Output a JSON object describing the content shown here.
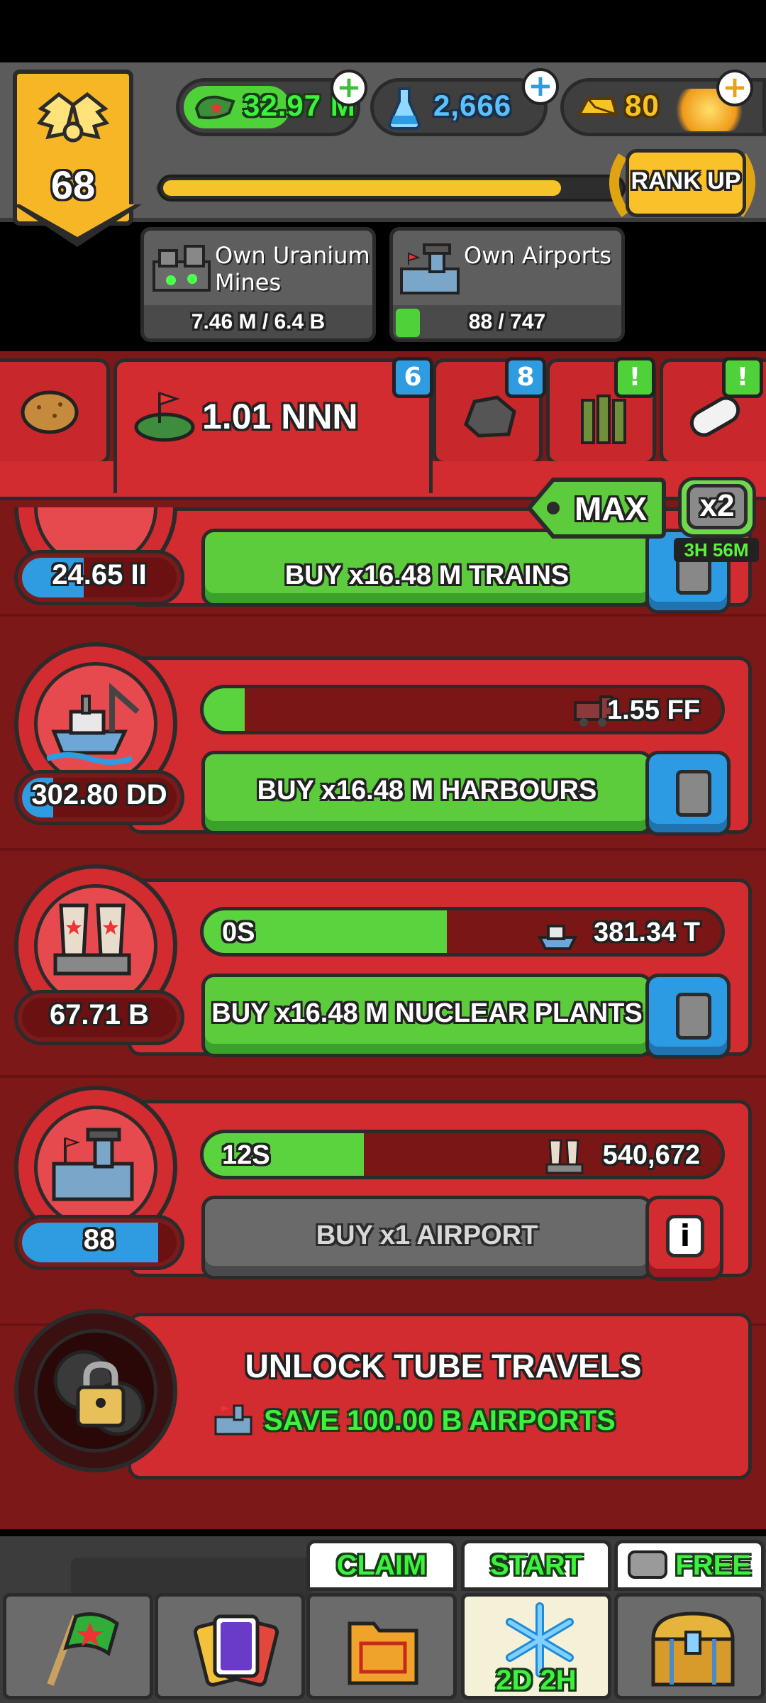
{
  "player": {
    "level": "68"
  },
  "resources": [
    {
      "name": "cash",
      "icon": "cash-icon",
      "value": "32.97 M"
    },
    {
      "name": "science",
      "icon": "flask-icon",
      "value": "2,666"
    },
    {
      "name": "gold",
      "icon": "gold-bar-icon",
      "value": "80"
    }
  ],
  "rank": {
    "button_label": "RANK UP",
    "progress_fraction": 0.86
  },
  "goals": [
    {
      "title_line1": "Own Uranium",
      "title_line2": "Mines",
      "progress": "7.46 M / 6.4 B",
      "icon": "uranium-mine-icon"
    },
    {
      "title_line1": "Own Airports",
      "title_line2": "",
      "progress": "88 / 747",
      "icon": "airport-icon"
    }
  ],
  "tabs": {
    "active_value": "1.01 NNN",
    "badges": [
      "6",
      "8",
      "!",
      "!"
    ]
  },
  "boost": {
    "max_label": "MAX",
    "multiplier_label": "x2",
    "timer": "3H 56M"
  },
  "rows": [
    {
      "name": "trains",
      "owned": "24.65 II",
      "buy_label": "BUY x16.48 M TRAINS"
    },
    {
      "name": "harbours",
      "owned": "302.80 DD",
      "bar_left": "",
      "bar_right": "1.55 FF",
      "bar_fill": 0.08,
      "buy_label": "BUY x16.48 M HARBOURS"
    },
    {
      "name": "nuclear-plants",
      "owned": "67.71 B",
      "bar_left": "0S",
      "bar_right": "381.34 T",
      "bar_fill": 0.47,
      "buy_label": "BUY x16.48 M NUCLEAR PLANTS"
    },
    {
      "name": "airports",
      "owned": "88",
      "bar_left": "12S",
      "bar_right": "540,672",
      "bar_fill": 0.31,
      "buy_label": "BUY x1 AIRPORT"
    }
  ],
  "unlock": {
    "title": "UNLOCK TUBE TRAVELS",
    "requirement": "SAVE 100.00 B AIRPORTS"
  },
  "nav": {
    "claim_label": "CLAIM",
    "start_label": "START",
    "free_label": "FREE",
    "event_timer": "2D 2H"
  },
  "colors": {
    "accent_green": "#5ccc3c",
    "panel_red": "#d22b30",
    "gold": "#f6b626",
    "blue": "#2f9be0"
  }
}
